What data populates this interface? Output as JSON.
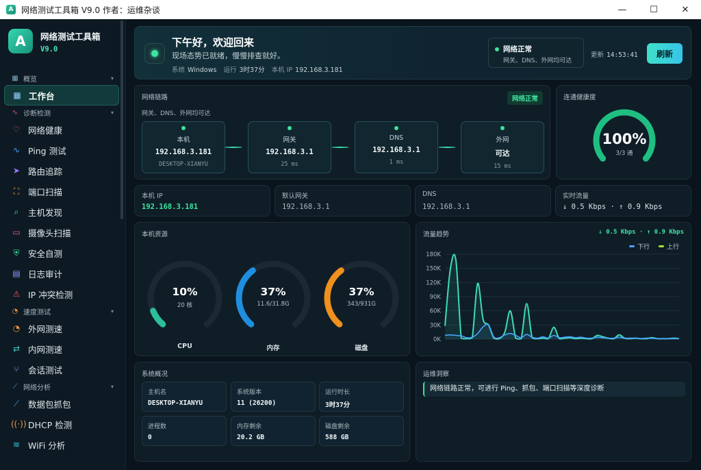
{
  "window": {
    "title": "网络测试工具箱 V9.0  作者：运维杂谈",
    "app_icon": "A",
    "min": "—",
    "max": "☐",
    "close": "✕"
  },
  "brand": {
    "name": "网络测试工具箱",
    "version": "V9.0",
    "logo": "A"
  },
  "sidebar": {
    "sections": [
      {
        "label": "概览",
        "icon": "grid-icon",
        "glyph": "▦",
        "color": "#7fa9c2",
        "items": [
          {
            "label": "工作台",
            "icon": "dashboard-icon",
            "glyph": "▦",
            "color": "#8fd3ff",
            "active": true
          }
        ]
      },
      {
        "label": "诊断检测",
        "icon": "pulse-icon",
        "glyph": "∿",
        "color": "#e25a6a",
        "items": [
          {
            "label": "网络健康",
            "icon": "heart-icon",
            "glyph": "♡",
            "color": "#ef5b6b"
          },
          {
            "label": "Ping 测试",
            "icon": "pulse-icon",
            "glyph": "∿",
            "color": "#4aa3ff"
          },
          {
            "label": "路由追踪",
            "icon": "send-icon",
            "glyph": "➤",
            "color": "#9b7bff"
          },
          {
            "label": "端口扫描",
            "icon": "scan-icon",
            "glyph": "⛶",
            "color": "#f0973a"
          },
          {
            "label": "主机发现",
            "icon": "search-icon",
            "glyph": "⌕",
            "color": "#3ee39f"
          },
          {
            "label": "摄像头扫描",
            "icon": "camera-icon",
            "glyph": "▭",
            "color": "#ef5b8b"
          },
          {
            "label": "安全自测",
            "icon": "shield-icon",
            "glyph": "⛨",
            "color": "#3ee39f"
          },
          {
            "label": "日志审计",
            "icon": "document-icon",
            "glyph": "▤",
            "color": "#8f9cff"
          },
          {
            "label": "IP 冲突检测",
            "icon": "warning-icon",
            "glyph": "⚠",
            "color": "#ef5b5b"
          }
        ]
      },
      {
        "label": "速度测试",
        "icon": "speedometer-icon",
        "glyph": "◔",
        "color": "#f0973a",
        "items": [
          {
            "label": "外网测速",
            "icon": "speedometer-icon",
            "glyph": "◔",
            "color": "#f0973a"
          },
          {
            "label": "内网测速",
            "icon": "swap-icon",
            "glyph": "⇄",
            "color": "#3ec8c8"
          },
          {
            "label": "会话测试",
            "icon": "fork-icon",
            "glyph": "⑂",
            "color": "#8f9cff"
          }
        ]
      },
      {
        "label": "网络分析",
        "icon": "trend-icon",
        "glyph": "⟋",
        "color": "#4aa3ff",
        "items": [
          {
            "label": "数据包抓包",
            "icon": "trend-icon",
            "glyph": "⟋",
            "color": "#4aa3ff"
          },
          {
            "label": "DHCP 检测",
            "icon": "signal-icon",
            "glyph": "((·))",
            "color": "#f0973a"
          },
          {
            "label": "WiFi 分析",
            "icon": "wifi-icon",
            "glyph": "≋",
            "color": "#3ec8e8"
          }
        ]
      }
    ]
  },
  "hero": {
    "greeting": "下午好，欢迎回来",
    "subtitle": "现场态势已就绪，慢慢排查就好。",
    "system_label": "系统",
    "system_value": "Windows",
    "uptime_label": "运行",
    "uptime_value": "3时37分",
    "ip_label": "本机 IP",
    "ip_value": "192.168.3.181",
    "status_title": "网络正常",
    "status_detail": "网关、DNS、外网均可达",
    "update_label": "更新",
    "update_time": "14:53:41",
    "refresh_label": "刷新"
  },
  "chain": {
    "title": "网络链路",
    "badge": "网络正常",
    "subtitle": "网关、DNS、外网均可达",
    "nodes": [
      {
        "label": "本机",
        "value": "192.168.3.181",
        "sub": "DESKTOP-XIANYU"
      },
      {
        "label": "网关",
        "value": "192.168.3.1",
        "sub": "25 ms"
      },
      {
        "label": "DNS",
        "value": "192.168.3.1",
        "sub": "1 ms"
      },
      {
        "label": "外网",
        "value": "可达",
        "sub": "15 ms"
      }
    ]
  },
  "health": {
    "title": "连通健康度",
    "percent": "100%",
    "percent_value": 100,
    "count": "3/3 通"
  },
  "mini": [
    {
      "label": "本机 IP",
      "value": "192.168.3.181"
    },
    {
      "label": "默认网关",
      "value": "192.168.3.1"
    },
    {
      "label": "DNS",
      "value": "192.168.3.1"
    },
    {
      "label": "实时流量",
      "value": "↓ 0.5 Kbps · ↑ 0.9 Kbps"
    }
  ],
  "resources": {
    "title": "本机资源",
    "gauges": [
      {
        "label": "CPU",
        "percent": "10%",
        "value": 10,
        "detail": "20 核",
        "color": "#2bbf9a"
      },
      {
        "label": "内存",
        "percent": "37%",
        "value": 37,
        "detail": "11.6/31.8G",
        "color": "#1e8fe0"
      },
      {
        "label": "磁盘",
        "percent": "37%",
        "value": 37,
        "detail": "343/931G",
        "color": "#f0901e"
      }
    ]
  },
  "traffic": {
    "title": "流量趋势",
    "rate": "↓ 0.5 Kbps · ↑ 0.9 Kbps",
    "legend_down": "下行",
    "legend_up": "上行",
    "color_down": "#4aa3ff",
    "color_up": "#a3e635",
    "yticks": [
      "180K",
      "150K",
      "120K",
      "90K",
      "60K",
      "30K",
      "0K"
    ]
  },
  "chart_data": {
    "type": "area",
    "title": "流量趋势",
    "ylim": [
      0,
      180000
    ],
    "yticks": [
      0,
      30000,
      60000,
      90000,
      120000,
      150000,
      180000
    ],
    "series": [
      {
        "name": "下行",
        "values": [
          28000,
          150000,
          168000,
          2000,
          1000,
          3000,
          118000,
          42000,
          30000,
          2000,
          1000,
          15000,
          60000,
          2000,
          1000,
          75000,
          3000,
          1000,
          2000,
          1000,
          25000,
          1000,
          2000,
          3000,
          1000,
          2000,
          1000,
          1000,
          8000,
          5000,
          2000,
          1000,
          9000,
          2000,
          1000,
          2000,
          1000,
          1000,
          3000,
          1000,
          1000,
          1000,
          2000,
          1000
        ]
      },
      {
        "name": "上行",
        "values": [
          8000,
          9000,
          8000,
          7000,
          3000,
          4000,
          12000,
          26000,
          30000,
          4000,
          3000,
          9000,
          12000,
          8000,
          3000,
          10000,
          4000,
          2000,
          5000,
          2000,
          8000,
          3000,
          4000,
          5000,
          3000,
          4000,
          2000,
          2000,
          4000,
          3000,
          2000,
          2000,
          4000,
          2000,
          2000,
          2000,
          1000,
          2000,
          2000,
          1000,
          1000,
          1000,
          1000,
          1000
        ]
      }
    ]
  },
  "system": {
    "title": "系统概况",
    "items": [
      {
        "label": "主机名",
        "value": "DESKTOP-XIANYU"
      },
      {
        "label": "系统版本",
        "value": "11 (26200)"
      },
      {
        "label": "运行时长",
        "value": "3时37分"
      },
      {
        "label": "进程数",
        "value": "0"
      },
      {
        "label": "内存剩余",
        "value": "20.2 GB"
      },
      {
        "label": "磁盘剩余",
        "value": "588 GB"
      }
    ]
  },
  "ops": {
    "title": "运维洞察",
    "note": "网络链路正常，可进行 Ping、抓包、端口扫描等深度诊断"
  }
}
